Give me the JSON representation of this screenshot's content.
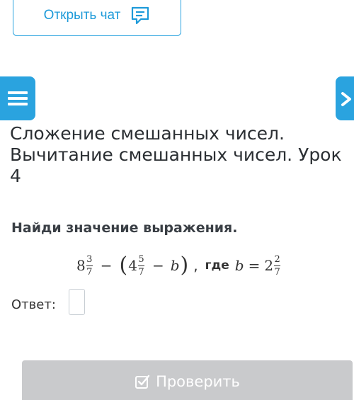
{
  "chat": {
    "label": "Открыть чат",
    "icon": "chat-icon"
  },
  "sidebar": {
    "menu_icon": "menu-icon",
    "next_icon": "chevron-right-icon"
  },
  "lesson": {
    "title": "Сложение смешанных чисел.\nВычитание смешанных чисел. Урок\n4"
  },
  "task": {
    "heading": "Найди значение выражения.",
    "expression": {
      "a_whole": "8",
      "a_num": "3",
      "a_den": "7",
      "minus1": "−",
      "b_whole": "4",
      "b_num": "5",
      "b_den": "7",
      "minus2": "−",
      "var": "b",
      "where": "где",
      "var2": "b",
      "eq": "=",
      "c_whole": "2",
      "c_num": "2",
      "c_den": "7"
    },
    "answer_label": "Ответ:",
    "answer_value": ""
  },
  "actions": {
    "check_label": "Проверить",
    "check_icon": "checkbox-check-icon"
  },
  "colors": {
    "accent": "#2aa3df",
    "button_disabled": "#c9cacc"
  }
}
